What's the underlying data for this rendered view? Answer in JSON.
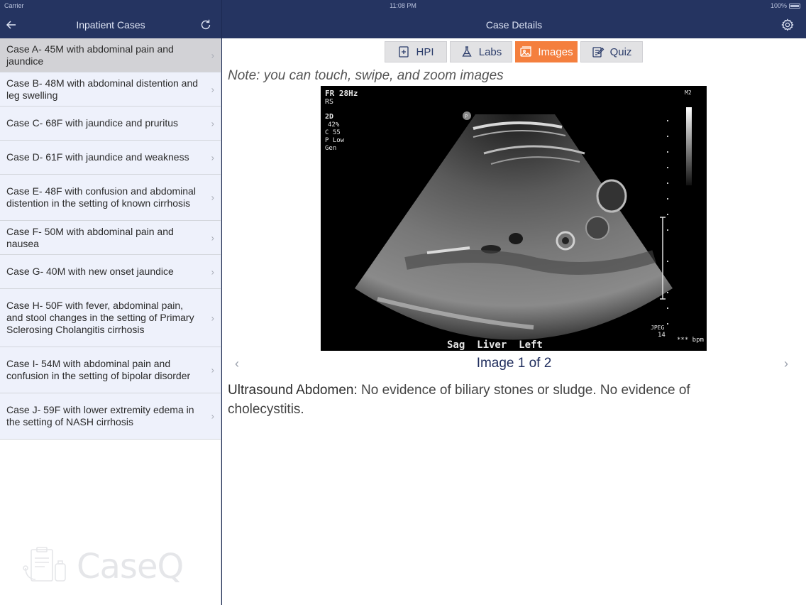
{
  "status": {
    "carrier": "Carrier",
    "time": "11:08 PM",
    "battery": "100%"
  },
  "left_nav": {
    "title": "Inpatient Cases"
  },
  "right_nav": {
    "title": "Case Details"
  },
  "cases": [
    {
      "label": "Case A- 45M with abdominal pain and jaundice"
    },
    {
      "label": "Case B- 48M with abdominal distention and leg swelling"
    },
    {
      "label": "Case C- 68F with jaundice and pruritus"
    },
    {
      "label": "Case D- 61F with jaundice and weakness"
    },
    {
      "label": "Case E- 48F with confusion and abdominal distention in the setting of known cirrhosis"
    },
    {
      "label": "Case F- 50M with abdominal pain and nausea"
    },
    {
      "label": "Case G- 40M with new onset jaundice"
    },
    {
      "label": "Case H- 50F with fever, abdominal pain, and stool changes in the setting of Primary Sclerosing Cholangitis cirrhosis"
    },
    {
      "label": "Case I- 54M with abdominal pain and confusion in the setting of bipolar disorder"
    },
    {
      "label": "Case J- 59F with lower extremity edema in the setting of NASH cirrhosis"
    }
  ],
  "logo": {
    "text": "CaseQ"
  },
  "tabs": {
    "hpi": "HPI",
    "labs": "Labs",
    "images": "Images",
    "quiz": "Quiz"
  },
  "note": "Note: you can touch, swipe, and zoom images",
  "ultrasound": {
    "fr": "FR 28Hz",
    "rs": "RS",
    "zd": "2D",
    "pct": "42%",
    "c": "C 55",
    "p": "P Low",
    "gen": "Gen",
    "m2": "M2",
    "jpeg": "JPEG",
    "jpeg_num": "14",
    "bpm": "*** bpm",
    "label": "Sag  Liver  Left",
    "marker": "P"
  },
  "caption": "Image 1 of 2",
  "description": {
    "label": "Ultrasound Abdomen:",
    "text": " No evidence of biliary stones or sludge. No evidence of cholecystitis."
  }
}
